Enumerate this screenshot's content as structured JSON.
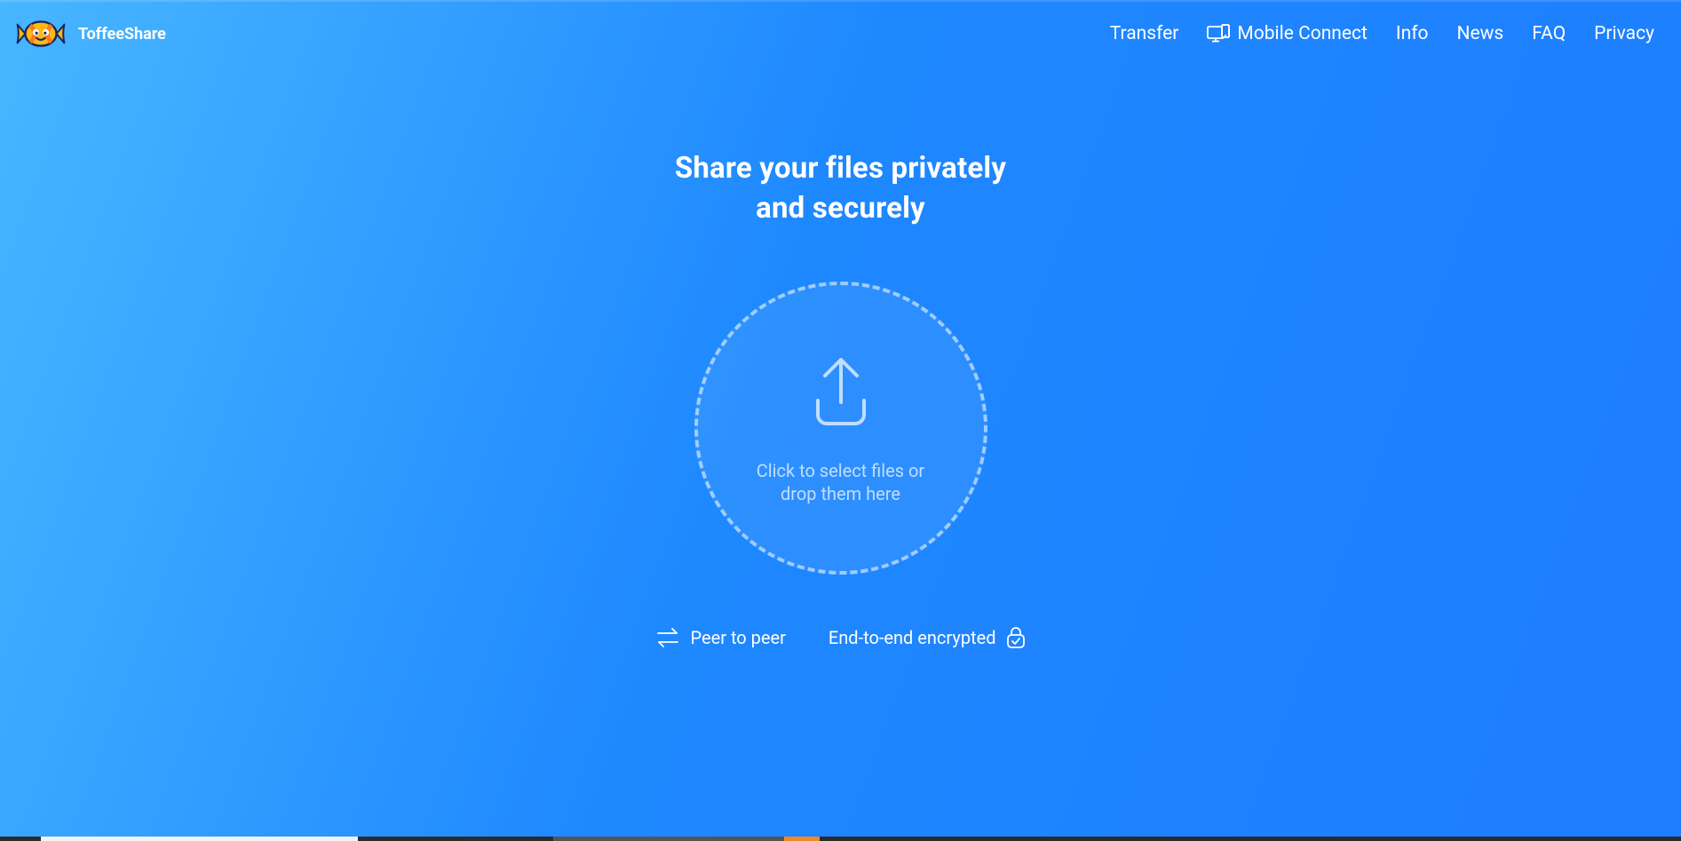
{
  "brand": {
    "name": "ToffeeShare"
  },
  "nav": {
    "transfer": "Transfer",
    "mobile_connect": "Mobile Connect",
    "info": "Info",
    "news": "News",
    "faq": "FAQ",
    "privacy": "Privacy"
  },
  "hero": {
    "line1": "Share your files privately",
    "line2": "and securely"
  },
  "dropzone": {
    "text": "Click to select files or drop them here"
  },
  "features": {
    "peer_to_peer": "Peer to peer",
    "e2e": "End-to-end encrypted"
  },
  "colors": {
    "candy_body": "#ffb816",
    "candy_stripe": "#ff7a1a",
    "candy_outline": "#17285e"
  }
}
